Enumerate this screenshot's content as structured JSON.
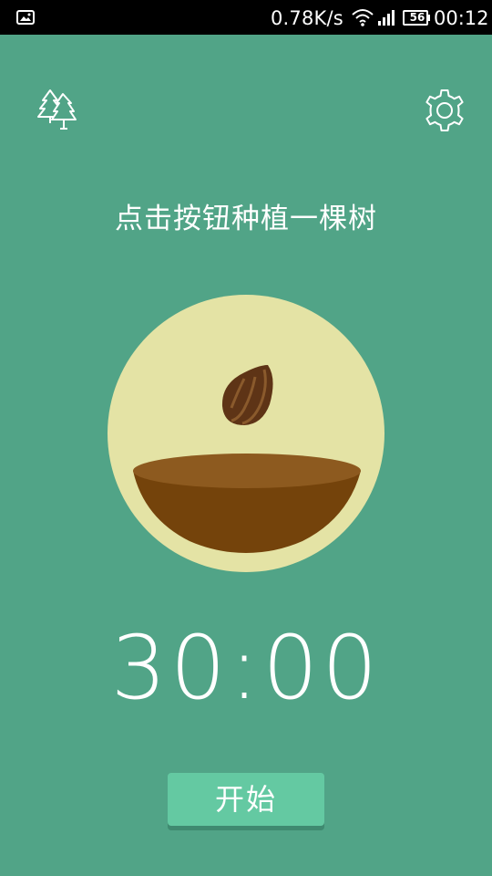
{
  "status_bar": {
    "network_speed": "0.78K/s",
    "battery_level": "56",
    "time": "00:12"
  },
  "icons": {
    "gallery": "gallery-icon",
    "wifi": "wifi-icon",
    "signal": "cellular-signal-icon",
    "battery": "battery-icon",
    "forest": "trees-icon",
    "settings": "gear-icon",
    "seed": "seed-icon",
    "soil": "soil-bowl-icon"
  },
  "main": {
    "prompt": "点击按钮种植一棵树",
    "timer": "30:00",
    "start_button": "开始"
  },
  "colors": {
    "background": "#51a487",
    "circle": "#e4e3a5",
    "soil": "#7a4a0c",
    "soil_top": "#8f5a1c",
    "button": "#64c9a2"
  }
}
